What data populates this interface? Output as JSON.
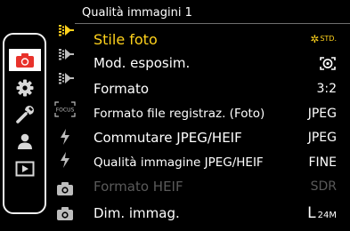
{
  "menu": {
    "title": "Qualità immagini 1"
  },
  "categories": [
    {
      "icon": "camera-icon",
      "label": "",
      "selected": true
    },
    {
      "icon": "gear-icon",
      "label": ""
    },
    {
      "icon": "wrench-icon",
      "label": ""
    },
    {
      "icon": "person-icon",
      "label": ""
    },
    {
      "icon": "playback-icon",
      "label": ""
    }
  ],
  "tabs": [
    {
      "icon": "image-quality-icon",
      "active": true
    },
    {
      "icon": "image-quality-icon"
    },
    {
      "icon": "image-quality-icon"
    },
    {
      "text": "FOCUS"
    },
    {
      "icon": "flash-icon"
    },
    {
      "icon": "flash-icon"
    },
    {
      "icon": "camera-small-icon"
    },
    {
      "icon": "camera-small-icon"
    }
  ],
  "items": [
    {
      "label": "Stile foto",
      "value": "STD.",
      "selected": true
    },
    {
      "label": "Mod. esposim.",
      "value": "",
      "value_icon": "metering-icon"
    },
    {
      "label": "Formato",
      "value": "3:2"
    },
    {
      "label": "Formato file registraz. (Foto)",
      "value": "JPEG"
    },
    {
      "label": "Commutare JPEG/HEIF",
      "value": "JPEG"
    },
    {
      "label": "Qualità immagine JPEG/HEIF",
      "value": "FINE"
    },
    {
      "label": "Formato HEIF",
      "value": "SDR",
      "disabled": true
    },
    {
      "label": "Dim. immag.",
      "value_main": "L",
      "value_sub": "24M"
    }
  ],
  "colors": {
    "accent_yellow": "#ffd21c",
    "camera_red": "#e8322b",
    "disabled_gray": "#5a5a5a"
  }
}
